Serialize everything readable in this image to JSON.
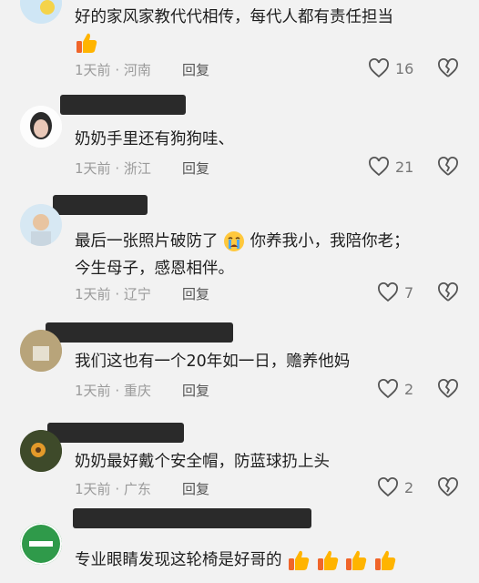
{
  "comments": [
    {
      "text_lines": [
        "好的家风家教代代相传，每代人都有责任担当"
      ],
      "emoji_after": [
        "thumbs-up"
      ],
      "time": "1天前",
      "location": "河南",
      "reply_label": "回复",
      "likes": "16"
    },
    {
      "text_lines": [
        "奶奶手里还有狗狗哇、"
      ],
      "time": "1天前",
      "location": "浙江",
      "reply_label": "回复",
      "likes": "21"
    },
    {
      "text_lines": [
        "最后一张照片破防了",
        "你养我小，我陪你老；",
        "今生母子，感恩相伴。"
      ],
      "time": "1天前",
      "location": "辽宁",
      "reply_label": "回复",
      "likes": "7"
    },
    {
      "text_lines": [
        "我们这也有一个20年如一日，赡养他妈"
      ],
      "time": "1天前",
      "location": "重庆",
      "reply_label": "回复",
      "likes": "2"
    },
    {
      "text_lines": [
        "奶奶最好戴个安全帽，防蓝球扔上头"
      ],
      "time": "1天前",
      "location": "广东",
      "reply_label": "回复",
      "likes": "2"
    },
    {
      "text_lines": [
        "专业眼睛发现这轮椅是好哥的"
      ],
      "emoji_after": [
        "thumbs-up",
        "thumbs-up",
        "thumbs-up",
        "thumbs-up"
      ]
    }
  ],
  "separator": "·",
  "icons": {
    "like": "heart-outline-icon",
    "dislike": "broken-heart-icon",
    "thumbs": "thumbs-up-emoji",
    "crying": "crying-face-emoji"
  }
}
